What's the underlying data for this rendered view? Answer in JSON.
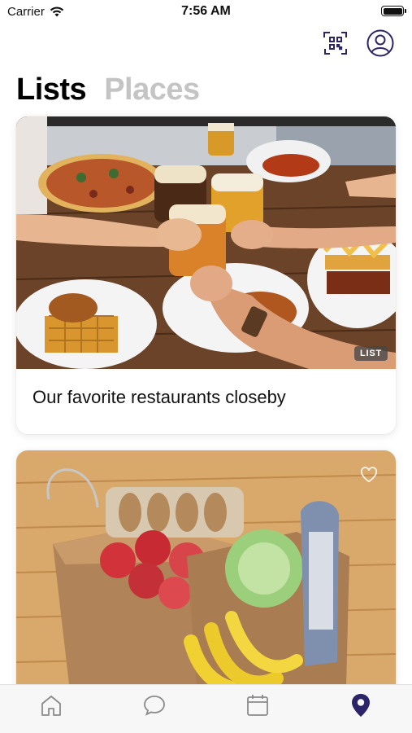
{
  "status_bar": {
    "carrier": "Carrier",
    "time": "7:56 AM"
  },
  "header": {
    "qr_icon": "qr-code-icon",
    "profile_icon": "user-circle-icon"
  },
  "segments": {
    "lists_label": "Lists",
    "places_label": "Places",
    "active": "Lists"
  },
  "cards": [
    {
      "title": "Our favorite restaurants closeby",
      "badge": "LIST",
      "image": "restaurant-table-photo"
    },
    {
      "title": "",
      "image": "grocery-bags-photo",
      "favorite_icon": "heart-outline-icon"
    }
  ],
  "tab_bar": {
    "items": [
      {
        "icon": "home-icon"
      },
      {
        "icon": "chat-bubble-icon"
      },
      {
        "icon": "calendar-icon"
      },
      {
        "icon": "map-pin-icon",
        "active": true
      }
    ]
  },
  "colors": {
    "accent": "#2b2468",
    "inactive_tab": "#8a8a8a",
    "inactive_segment": "#c4c4c4"
  }
}
